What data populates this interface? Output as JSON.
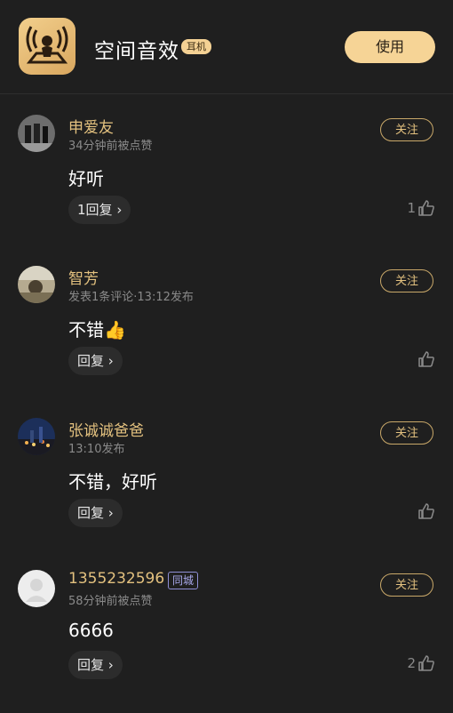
{
  "header": {
    "title": "空间音效",
    "tag": "耳机",
    "use_button": "使用"
  },
  "comments": [
    {
      "name": "申爱友",
      "meta": "34分钟前被点赞",
      "text": "好听",
      "reply_label": "1回复",
      "likes": "1",
      "follow": "关注"
    },
    {
      "name": "智芳",
      "meta": "发表1条评论·13:12发布",
      "text": "不错👍",
      "reply_label": "回复",
      "likes": "",
      "follow": "关注"
    },
    {
      "name": "张诚诚爸爸",
      "meta": "13:10发布",
      "text": "不错，好听",
      "reply_label": "回复",
      "likes": "",
      "follow": "关注"
    },
    {
      "name": "1355232596",
      "city_tag": "同城",
      "meta": "58分钟前被点赞",
      "text": "6666",
      "reply_label": "回复",
      "likes": "2",
      "follow": "关注"
    }
  ]
}
